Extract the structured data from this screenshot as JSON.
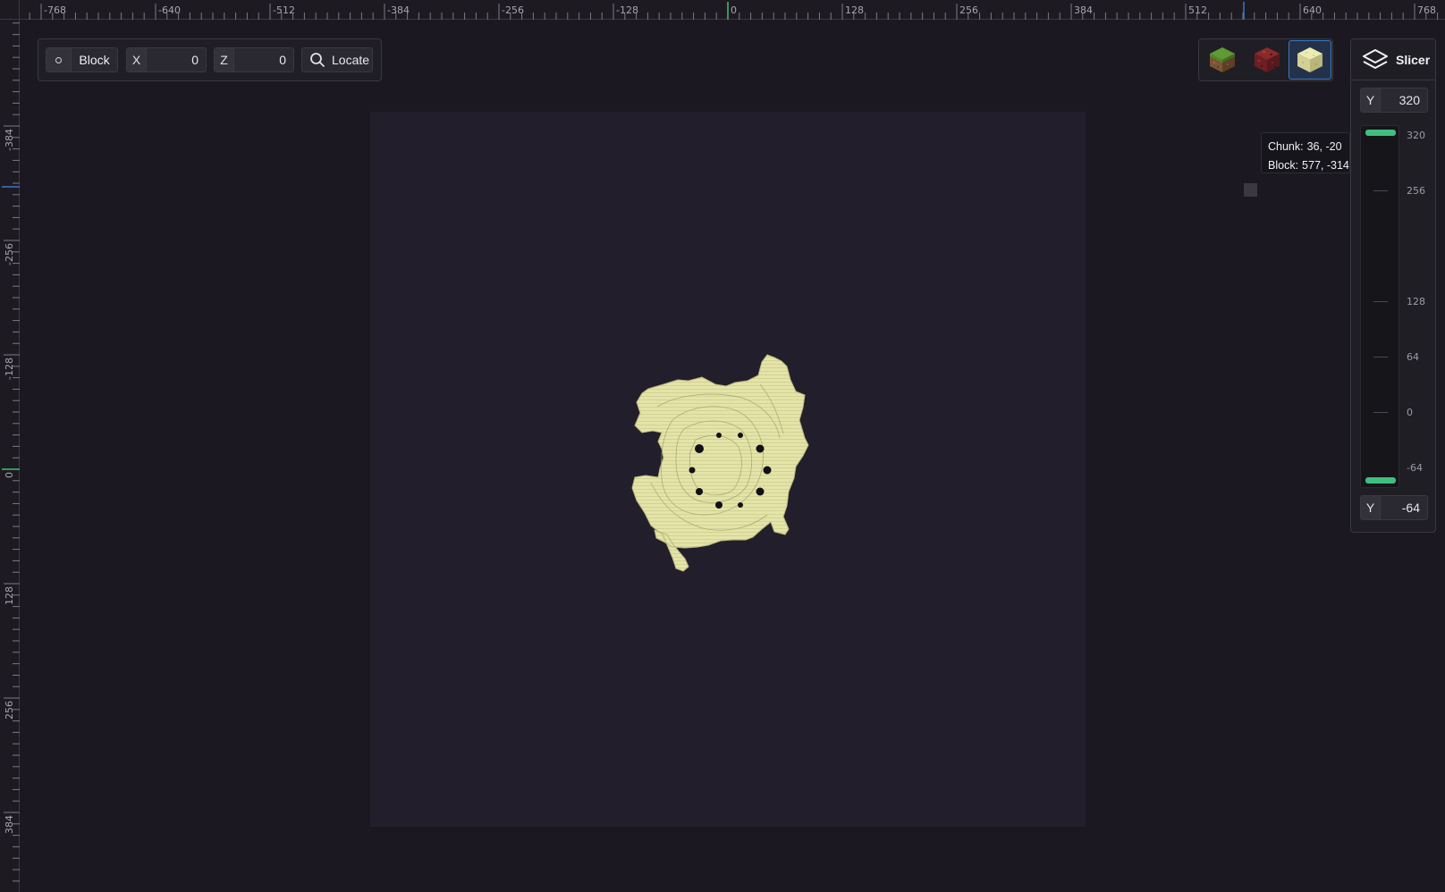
{
  "ruler": {
    "top_labels": [
      "-768",
      "-640",
      "-512",
      "-384",
      "-256",
      "-128",
      "0",
      "128",
      "256",
      "384",
      "512",
      "640",
      "768"
    ],
    "left_labels": [
      "-384",
      "-256",
      "-128",
      "0",
      "128",
      "256",
      "384"
    ]
  },
  "toolbar": {
    "mode_label": "Block",
    "x_axis": "X",
    "x_value": "0",
    "z_axis": "Z",
    "z_value": "0",
    "locate_label": "Locate"
  },
  "materials": [
    {
      "name": "grass-block",
      "selected": false
    },
    {
      "name": "netherrack-block",
      "selected": false
    },
    {
      "name": "end-stone-block",
      "selected": true
    }
  ],
  "slicer": {
    "title": "Slicer",
    "top_axis": "Y",
    "top_value": "320",
    "bottom_axis": "Y",
    "bottom_value": "-64",
    "scale_labels": [
      "320",
      "256",
      "128",
      "64",
      "0",
      "-64"
    ]
  },
  "tooltip": {
    "chunk_key": "Chunk:",
    "chunk_value": "36, -20",
    "block_key": "Block:",
    "block_value": "577, -314"
  },
  "colors": {
    "background": "#1b1821",
    "world": "#231e2b",
    "terrain": "#e6e6aa",
    "accent": "#3b78c4",
    "handle": "#3fbf7f"
  },
  "icons": {
    "locate": "search-icon",
    "slicer": "layers-icon",
    "mode": "circle-dot-icon"
  }
}
